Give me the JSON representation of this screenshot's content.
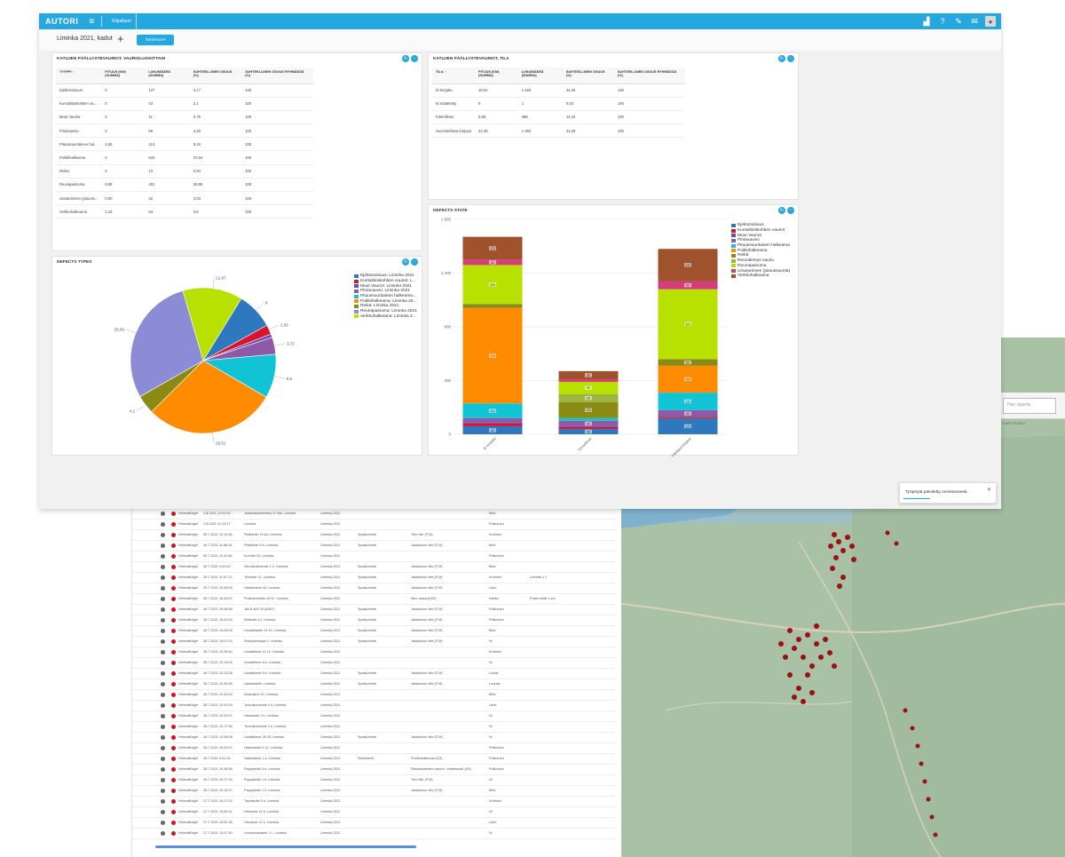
{
  "app": {
    "logo": "AUTORI",
    "menu_icon": "≡",
    "nav_tab": "Kilpailuun",
    "colors": {
      "accent": "#25a8e0",
      "panel_bg": "#ffffff",
      "app_bg": "#f1f1f1"
    }
  },
  "topbar_icons": [
    {
      "name": "factory-icon",
      "glyph": "▟"
    },
    {
      "name": "help-icon",
      "glyph": "?"
    },
    {
      "name": "tools-icon",
      "glyph": "✎"
    },
    {
      "name": "chat-icon",
      "glyph": "✉"
    },
    {
      "name": "user-avatar-icon",
      "glyph": "●"
    }
  ],
  "dashboard": {
    "title": "Liminka 2021, kadut",
    "plus": "+",
    "action_button": "Toiminnot ▾"
  },
  "panel_defects_by_class": {
    "title": "KATUJEN PÄÄLLYSTEVAURIOT, VAURIOLUOKITTAIN",
    "columns": [
      "TYYPPI ↑",
      "PITUUS (KM) (SUMMA)",
      "LUKUMÄÄRÄ (SUMMA)",
      "SUHTEELLINEN OSUUS (%)",
      "SUHTEELLINEN OSUUS RYHMÄSSÄ (%)"
    ],
    "rows": [
      [
        "Ejektosoisuus",
        "0",
        "127",
        "3,17",
        "100"
      ],
      [
        "Kuntaliitoskohtien va...",
        "0",
        "43",
        "2,1",
        "100"
      ],
      [
        "Muut Vauriot",
        "0",
        "11",
        "0,75",
        "100"
      ],
      [
        "Pintavauvio",
        "0",
        "59",
        "4,26",
        "100"
      ],
      [
        "Pituussuuntainen hal...",
        "4,56",
        "113",
        "8,16",
        "100"
      ],
      [
        "Poikkihalkeama",
        "0",
        "522",
        "37,64",
        "100"
      ],
      [
        "Reikä",
        "0",
        "13",
        "0,94",
        "100"
      ],
      [
        "Reunapainuma",
        "8,89",
        "401",
        "28,95",
        "100"
      ],
      [
        "Urautuminen (pituuss...",
        "0,00",
        "42",
        "3,03",
        "100"
      ],
      [
        "Verkkohalkeama",
        "1,16",
        "54",
        "3,9",
        "100"
      ]
    ]
  },
  "panel_defects_state": {
    "title": "KATUJEN PÄÄLLYSTEVAURIOT, TILA",
    "columns": [
      "TILA ↑",
      "PITUUS (KM) (SUMMA)",
      "LUKUMÄÄRÄ (SUMMA)",
      "SUHTEELLINEN OSUUS (%)",
      "SUHTEELLINEN OSUUS RYHMÄSSÄ (%)"
    ],
    "rows": [
      [
        "Ei korjattu",
        "18,64",
        "1 493",
        "44,26",
        "100"
      ],
      [
        "Ei määritetty",
        "0",
        "1",
        "0,03",
        "100"
      ],
      [
        "Kiireellinen",
        "5,86",
        "486",
        "14,42",
        "100"
      ],
      [
        "Suunniteltava korjaus",
        "44,39",
        "1 392",
        "41,29",
        "100"
      ]
    ]
  },
  "panel_pie": {
    "title": "DEFECTS TYPES",
    "button_glyphs": [
      "↻",
      "⋯"
    ]
  },
  "panel_bars": {
    "title": "DEFECTS STATE"
  },
  "chart_data": [
    {
      "type": "pie",
      "title": "DEFECTS TYPES",
      "categories": [
        "Ejektosoisuus: Liminka 2021",
        "Kuntaliitoskohtien vauriot: L...",
        "Muut Vauriot: Liminka 2021",
        "Pintavauvio: Liminka 2021",
        "Pituussuuntainen halkeama...",
        "Poikkihalkeama: Liminka 20...",
        "Reikä: Liminka 2021",
        "Reunapainuma: Liminka 2021",
        "Verkkohalkeama: Liminka 2..."
      ],
      "values": [
        8,
        2.06,
        0.75,
        3.72,
        9.5,
        28.51,
        4.1,
        28.03,
        12.97
      ],
      "data_labels": [
        "8",
        "2,06",
        "",
        "3,72",
        "9,5",
        "28,51",
        "4,1",
        "28,03",
        "12,97"
      ],
      "colors": [
        "#2e78bf",
        "#d9142b",
        "#6a4fb3",
        "#8e5aa6",
        "#10c4d6",
        "#ff8c00",
        "#8a8a14",
        "#8c8cd6",
        "#b8e000"
      ]
    },
    {
      "type": "bar",
      "stacked": true,
      "title": "DEFECTS STATE",
      "categories": [
        "Ei korjattu",
        "Kiireellinen",
        "Suunniteltava korjaus"
      ],
      "ylim": [
        0,
        1600
      ],
      "yticks": [
        "0",
        "400",
        "800",
        "1 200",
        "1 600"
      ],
      "series": [
        {
          "name": "Ejektosoisuus",
          "color": "#2e78bf",
          "values": [
            60,
            40,
            120
          ]
        },
        {
          "name": "Kuntaliitoskohtien vauriot",
          "color": "#d9142b",
          "values": [
            20,
            15,
            10
          ]
        },
        {
          "name": "Muut Vauriot",
          "color": "#6a4fb3",
          "values": [
            10,
            5,
            0
          ]
        },
        {
          "name": "Pintavauvio",
          "color": "#8e5aa6",
          "values": [
            30,
            40,
            50
          ]
        },
        {
          "name": "Pituussuuntainen halkeama",
          "color": "#10c4d6",
          "values": [
            110,
            20,
            130
          ]
        },
        {
          "name": "Poikkihalkeama",
          "color": "#ff8c00",
          "values": [
            710,
            0,
            200
          ]
        },
        {
          "name": "Reikä",
          "color": "#8a8a14",
          "values": [
            30,
            120,
            50
          ]
        },
        {
          "name": "Reunapainuma",
          "color": "#9cb53c",
          "values": [
            0,
            60,
            0
          ]
        },
        {
          "name": "Reunapainuma ",
          "color": "#b8e000",
          "values": [
            290,
            90,
            520
          ]
        },
        {
          "name": "Urautuminen (pituussuunta)",
          "color": "#d63e7a",
          "values": [
            40,
            20,
            60
          ]
        },
        {
          "name": "Verkkohalkeama",
          "color": "#a0522d",
          "values": [
            170,
            60,
            240
          ]
        }
      ],
      "legend": [
        "Ejektosoisuus",
        "Kuntaliitoskohtien vauriot",
        "Muut Vauriot",
        "Pintavauvio",
        "Pituussuuntainen halkeama",
        "Poikkihalkeama",
        "Reikä",
        "Reunakireys vaurio",
        "Reunapainuma",
        "Urautuminen (pituussuunta)",
        "Verkkohalkeama"
      ],
      "legend_colors": [
        "#2e78bf",
        "#d9142b",
        "#6a4fb3",
        "#8e5aa6",
        "#10c4d6",
        "#ff8c00",
        "#8a8a14",
        "#9cb53c",
        "#b8e000",
        "#d63e7a",
        "#a0522d"
      ]
    }
  ],
  "toast": {
    "text": "Työpöytä päivitetty onnistuneesti.",
    "close": "✕"
  },
  "background_table": {
    "rows": [
      [
        "HelenaBright",
        "2.8.2021 12:02:00",
        "Joukkotyöskentely 47 äät, Liminka",
        "Liminka 2021",
        "",
        "",
        "Bleb",
        ""
      ],
      [
        "HelenaBright",
        "2.8.2021 12:19:17",
        "Liminka",
        "Liminka 2021",
        "",
        "",
        "Polkuinen",
        ""
      ],
      [
        "HelenaBright",
        "30.7.2021 12:11:06",
        "Pietiläntie 19 b2, Liminka",
        "Liminka 2021",
        "Spaksumetri",
        "Tien riite (F13)",
        "Kortinen",
        ""
      ],
      [
        "HelenaBright",
        "30.7.2021 11:58:44",
        "Pietiläntie 5 b, Liminka",
        "Liminka 2021",
        "Spaksumetri",
        "Jalankulun riite (F19)",
        "Bleb",
        ""
      ],
      [
        "HelenaBright",
        "30.7.2021 11:41:56",
        "Kurintie 33, Liminka",
        "Liminka 2021",
        "",
        "",
        "Polkuinen",
        ""
      ],
      [
        "HelenaBright",
        "30.7.2021 9:49:43",
        "Vennikutiesentie 1 2, Liminka",
        "Liminka 2021",
        "Spaksumetri",
        "Jalankulun riite (F19)",
        "Bleb",
        ""
      ],
      [
        "HelenaBright",
        "29.7.2021 11:57:12",
        "Tiinuntie 12, Liminka",
        "Liminka 2021",
        "Spaksumetri",
        "Jalankulun riite (F19)",
        "Kortinen",
        "Limintie 1 1"
      ],
      [
        "HelenaBright",
        "29.7.2021 10:55:09",
        "Hautieniemi 40, Liminka",
        "Liminka 2021",
        "Spaksumetri",
        "Jalankulun riite (F19)",
        "Läne",
        ""
      ],
      [
        "HelenaBright",
        "28.7.2021 16:46:07",
        "Puistokuntatie 16 02, Liminka",
        "Liminka 2021",
        "",
        "Muu vaara (H20)",
        "Nekku",
        "Puisto tiellä 1 km"
      ],
      [
        "HelenaBright",
        "28.7.2021 15:08:56",
        "Jäu 8 a00 29 (4087)",
        "Liminka 2021",
        "Spaksumetri",
        "Jalankulun riite (F19)",
        "Polkuinen",
        ""
      ],
      [
        "HelenaBright",
        "28.7.2021 15:00:02",
        "Kirkkotie 12, Liminka",
        "Liminka 2021",
        "Spaksumetri",
        "Jalankulun riite (F19)",
        "Polkuinen",
        ""
      ],
      [
        "HelenaBright",
        "28.7.2021 14:09:09",
        "Liimattilantie 14 19, Liminka",
        "Liminka 2021",
        "Spaksumetri",
        "Jalankulun riite (F19)",
        "Bleb",
        ""
      ],
      [
        "HelenaBright",
        "28.7.2021 14:07:14",
        "Rekkosentupa 2, Liminka",
        "Liminka 2021",
        "Spaksumetri",
        "Jalankulun riite (F19)",
        "Ni",
        ""
      ],
      [
        "HelenaBright",
        "28.7.2021 13:36:44",
        "Limattitiene 11 12, Liminka",
        "Liminka 2021",
        "",
        "",
        "Kortinen",
        ""
      ],
      [
        "HelenaBright",
        "28.7.2021 13:19:09",
        "Limattitiene 8 b, Liminka",
        "Liminka 2021",
        "",
        "",
        "Ni",
        ""
      ],
      [
        "HelenaBright",
        "28.7.2021 13:13:36",
        "Limattitiene 6 b, Liminka",
        "Liminka 2021",
        "Spaksumetri",
        "Jalankulun riite (F19)",
        "Luode",
        ""
      ],
      [
        "HelenaBright",
        "28.7.2021 12:45:48",
        "Latsiustietie, Liminka",
        "Liminka 2021",
        "Spaksumetri",
        "Jalankulun riite (F19)",
        "Lounas",
        ""
      ],
      [
        "HelenaBright",
        "28.7.2021 12:46:04",
        "Kirkkojärvi 12, Liminka",
        "Liminka 2021",
        "",
        "",
        "Bleb",
        ""
      ],
      [
        "HelenaBright",
        "28.7.2021 12:42:09",
        "Tuomikuutentie 4 9, Liminka",
        "Liminka 2021",
        "",
        "",
        "Läne",
        ""
      ],
      [
        "HelenaBright",
        "28.7.2021 12:30:07",
        "Hankantie 1 b, Liminka",
        "Liminka 2021",
        "",
        "",
        "Ni",
        ""
      ],
      [
        "HelenaBright",
        "28.7.2021 12:17:56",
        "Tuomikuutentie 1 b, Liminka",
        "Liminka 2021",
        "",
        "",
        "Ni",
        ""
      ],
      [
        "HelenaBright",
        "28.7.2021 12:08:08",
        "Limattitiene 26 05, Liminka",
        "Liminka 2021",
        "Spaksumetri",
        "Jalankulun riite (F19)",
        "Ni",
        ""
      ],
      [
        "HelenaBright",
        "28.7.2021 10:09:07",
        "Hakanantie 6 12, Liminka",
        "Liminka 2021",
        "",
        "",
        "Polkuinen",
        ""
      ],
      [
        "HelenaBright",
        "28.7.2021 9:51:34",
        "Hakanantie 1 a, Liminka",
        "Liminka 2021",
        "Steinbrenti",
        "Puuttomattomat (G2)",
        "Polkuinen",
        ""
      ],
      [
        "HelenaBright",
        "28.7.2021 10:38:56",
        "Pappilantie 5 b, Liminka",
        "Liminka 2021",
        "",
        "Raivatustiehen vauriot / erkaltomalt (H3)",
        "Polkuinen",
        ""
      ],
      [
        "HelenaBright",
        "28.7.2021 10:27:34",
        "Pappilantie 1 b, Liminka",
        "Liminka 2021",
        "",
        "Tien riite (F13)",
        "Ni",
        ""
      ],
      [
        "HelenaBright",
        "28.7.2021 10:18:27",
        "Pappilantie 1 2, Liminka",
        "Liminka 2021",
        "",
        "Jalankulun riite (F19)",
        "Bleb",
        ""
      ],
      [
        "HelenaBright",
        "27.7.2021 14:27:02",
        "Tupolantie 3 b, Liminka",
        "Liminka 2021",
        "",
        "",
        "Kortinen",
        ""
      ],
      [
        "HelenaBright",
        "27.7.2021 13:59:11",
        "Heeranie 12 b, Liminka",
        "Liminka 2021",
        "",
        "",
        "Ni",
        ""
      ],
      [
        "HelenaBright",
        "27.7.2021 13:51:36",
        "Heeranie 12 b, Liminka",
        "Liminka 2021",
        "",
        "",
        "Läne",
        ""
      ],
      [
        "HelenaBright",
        "27.7.2021 13:47:40",
        "Leinusmaraarie 1 2, Liminka",
        "Liminka 2021",
        "",
        "",
        "Ni",
        ""
      ]
    ]
  },
  "map": {
    "search_placeholder": "Hae sijainta",
    "search_item": "KARTTATASO"
  }
}
